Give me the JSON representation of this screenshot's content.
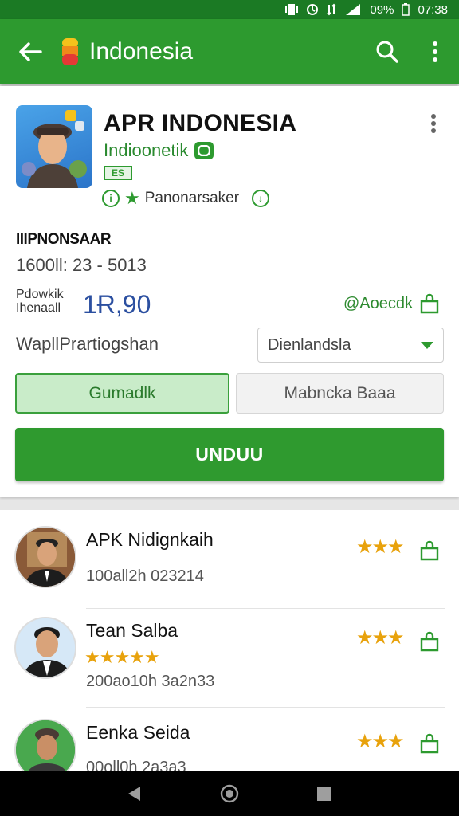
{
  "status_bar": {
    "battery": "09%",
    "time": "07:38"
  },
  "app_bar": {
    "title": "Indonesia",
    "back_icon": "arrow-left-icon",
    "search_icon": "search-icon",
    "more_icon": "more-vert-icon"
  },
  "app": {
    "title": "APR INDONESIA",
    "developer": "Indioonetik",
    "tag": "ES",
    "meta_label": "Panonarsaker",
    "section_heading": "IIIPNONSAAR",
    "section_sub": "1600ll: 23 - 5013",
    "price_label": "Pdowkik Ihenaall",
    "price_value": "1Ɍ,90",
    "price_link": "@Aoecdk",
    "wp_label": "WapllPrartiogshan",
    "dropdown_value": "Dienlandsla",
    "btn_a": "Gumadlk",
    "btn_b": "Mabncka Baaa",
    "btn_main": "UNDUU",
    "colors": {
      "accent": "#2d9a2f",
      "price": "#2b4fa0",
      "star": "#e8a20c"
    }
  },
  "list": {
    "items": [
      {
        "name": "APK Nidignkaih",
        "meta": "100all2h 023214",
        "rating_stars": 3,
        "inline_stars": 0
      },
      {
        "name": "Tean Salba",
        "meta": "200ao10h 3a2n33",
        "rating_stars": 3,
        "inline_stars": 5
      },
      {
        "name": "Eenka Seida",
        "meta": "00oll0h 2a3a3",
        "rating_stars": 3,
        "inline_stars": 0
      }
    ]
  },
  "nav": {
    "back": "back-triangle-icon",
    "home": "home-circle-icon",
    "recents": "recents-square-icon"
  }
}
